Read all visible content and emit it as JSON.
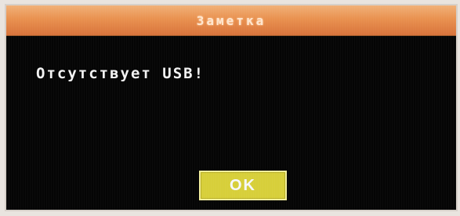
{
  "dialog": {
    "title": "Заметка",
    "message": "Отсутствует USB!",
    "ok_label": "OK"
  },
  "colors": {
    "title_bar": "#e9914f",
    "dialog_bg": "#050505",
    "ok_button": "#d7cf3a"
  }
}
